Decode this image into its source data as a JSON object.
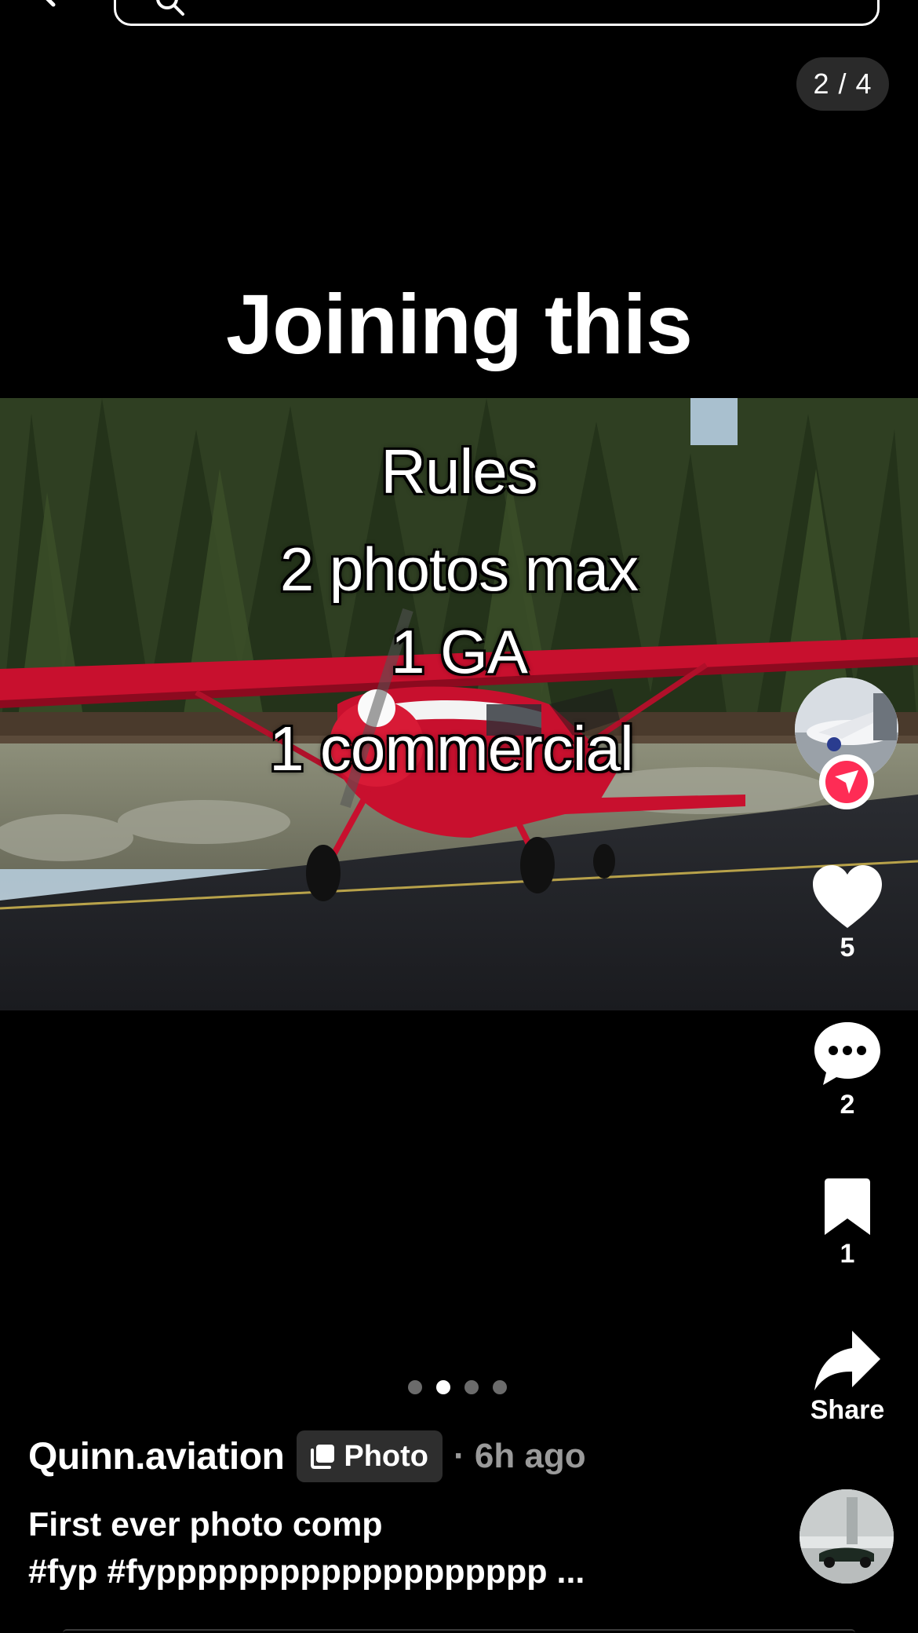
{
  "page_counter": "2 / 4",
  "slide": {
    "title": "Joining this",
    "overlay_lines": [
      "Rules",
      "2 photos max",
      "1 GA",
      "1 commercial"
    ]
  },
  "actions": {
    "likes": "5",
    "comments": "2",
    "saves": "1",
    "share_label": "Share"
  },
  "carousel": {
    "total": 4,
    "active_index": 1
  },
  "post": {
    "author": "Quinn.aviation",
    "type_label": "Photo",
    "time_ago": "· 6h ago",
    "caption_line1": "First ever photo comp",
    "caption_line2": "#fyp #fyppppppppppppppppppp ..."
  },
  "colors": {
    "background": "#000000",
    "follow_accent": "#fe2c55",
    "chip_bg": "#2e2e2e",
    "muted_text": "#9a9a9a",
    "plane_red": "#c8102e"
  },
  "icons": {
    "back": "chevron-left-icon",
    "search": "search-icon",
    "follow": "send-arrow-icon",
    "like": "heart-icon",
    "comment": "comment-bubble-icon",
    "save": "bookmark-icon",
    "share": "share-arrow-icon",
    "photo_chip": "photo-stack-icon"
  }
}
